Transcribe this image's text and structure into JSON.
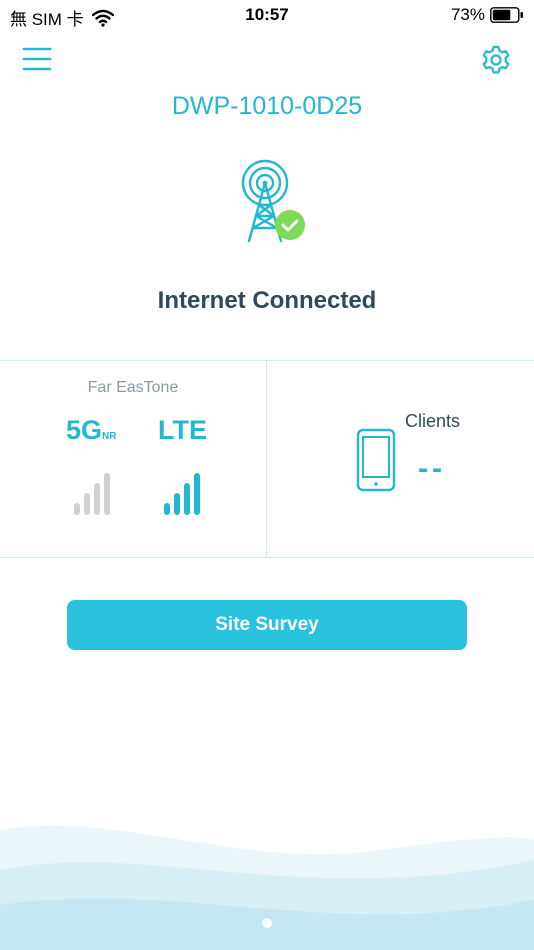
{
  "status_bar": {
    "carrier": "無 SIM 卡",
    "time": "10:57",
    "battery": "73%"
  },
  "header": {
    "device_name": "DWP-1010-0D25"
  },
  "connection": {
    "status": "Internet Connected"
  },
  "network": {
    "carrier": "Far EasTone",
    "tech_5g": "5G",
    "tech_5g_sub": "NR",
    "tech_lte": "LTE",
    "signal_5g_level": 0,
    "signal_lte_level": 4,
    "signal_max": 4
  },
  "clients": {
    "label": "Clients",
    "count": "--"
  },
  "actions": {
    "site_survey": "Site Survey"
  },
  "colors": {
    "accent": "#22b8cf",
    "button": "#29c3df",
    "text_dark": "#2e4a5c",
    "check_green": "#7ed957",
    "bar_inactive": "#d0d0d0"
  },
  "icons": {
    "menu": "menu-icon",
    "settings": "gear-icon",
    "tower": "tower-icon",
    "check": "check-icon",
    "phone": "phone-icon"
  }
}
